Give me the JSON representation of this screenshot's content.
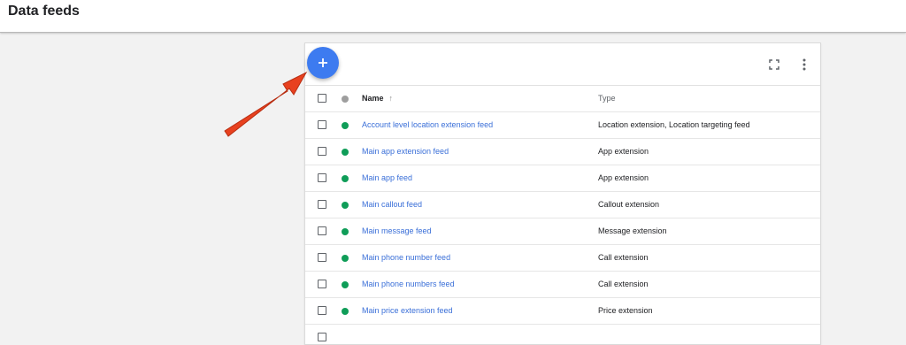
{
  "header": {
    "title": "Data feeds"
  },
  "toolbar": {
    "add_icon": "plus-icon",
    "fullscreen_icon": "fullscreen-icon",
    "more_icon": "more-vert-icon"
  },
  "table": {
    "columns": {
      "name": "Name",
      "type": "Type"
    },
    "sort_icon": "arrow-up-icon",
    "rows": [
      {
        "name": "Account level location extension feed",
        "type": "Location extension, Location targeting feed",
        "status": "enabled"
      },
      {
        "name": "Main app extension feed",
        "type": "App extension",
        "status": "enabled"
      },
      {
        "name": "Main app feed",
        "type": "App extension",
        "status": "enabled"
      },
      {
        "name": "Main callout feed",
        "type": "Callout extension",
        "status": "enabled"
      },
      {
        "name": "Main message feed",
        "type": "Message extension",
        "status": "enabled"
      },
      {
        "name": "Main phone number feed",
        "type": "Call extension",
        "status": "enabled"
      },
      {
        "name": "Main phone numbers feed",
        "type": "Call extension",
        "status": "enabled"
      },
      {
        "name": "Main price extension feed",
        "type": "Price extension",
        "status": "enabled"
      }
    ]
  },
  "colors": {
    "status_enabled": "#0f9d58",
    "status_header": "#9e9e9e",
    "link": "#3a6fd8",
    "fab": "#3d7bf0",
    "annotation_arrow": "#e8411f"
  }
}
